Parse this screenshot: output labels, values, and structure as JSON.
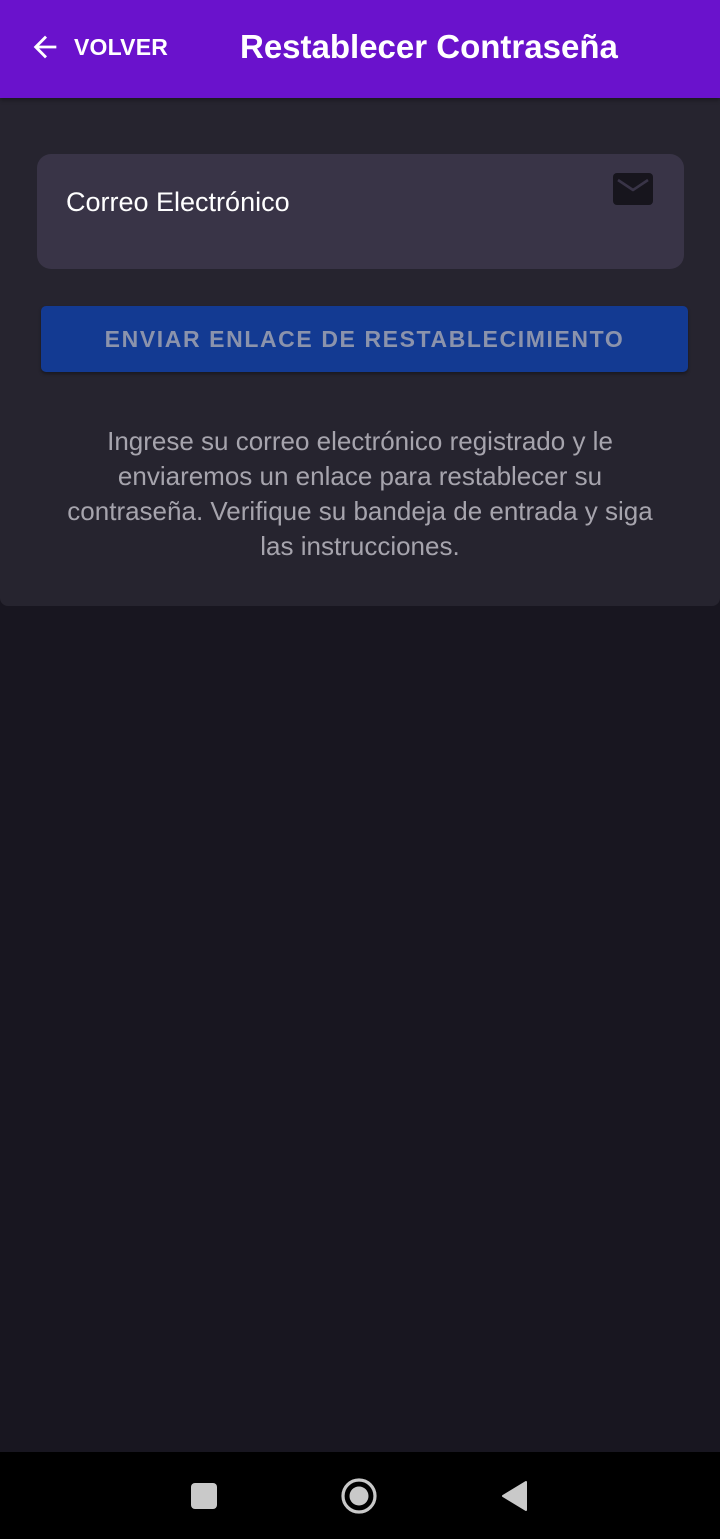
{
  "app_bar": {
    "back_label": "VOLVER",
    "back_icon": "arrow-left-icon",
    "title": "Restablecer Contraseña",
    "background_color": "#6a12cc"
  },
  "form": {
    "email_label": "Correo Electrónico",
    "email_icon": "mail-icon",
    "submit_label": "ENVIAR ENLACE DE RESTABLECIMIENTO",
    "submit_color": "#133a92",
    "help_text": "Ingrese su correo electrónico registrado y le enviaremos un enlace para restablecer su contraseña. Verifique su bandeja de entrada y siga las instrucciones."
  },
  "system_nav": {
    "recents_icon": "square-icon",
    "home_icon": "circle-home-icon",
    "back_icon": "triangle-back-icon"
  }
}
